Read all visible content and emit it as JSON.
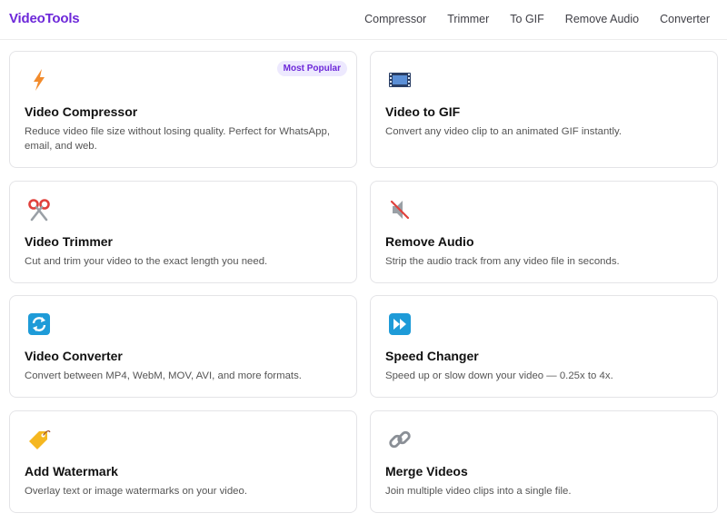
{
  "brand": "VideoTools",
  "nav": [
    "Compressor",
    "Trimmer",
    "To GIF",
    "Remove Audio",
    "Converter"
  ],
  "badge": "Most Popular",
  "cards": [
    {
      "title": "Video Compressor",
      "desc": "Reduce video file size without losing quality. Perfect for WhatsApp, email, and web.",
      "icon": "lightning-icon"
    },
    {
      "title": "Video to GIF",
      "desc": "Convert any video clip to an animated GIF instantly.",
      "icon": "film-icon"
    },
    {
      "title": "Video Trimmer",
      "desc": "Cut and trim your video to the exact length you need.",
      "icon": "scissors-icon"
    },
    {
      "title": "Remove Audio",
      "desc": "Strip the audio track from any video file in seconds.",
      "icon": "muted-speaker-icon"
    },
    {
      "title": "Video Converter",
      "desc": "Convert between MP4, WebM, MOV, AVI, and more formats.",
      "icon": "convert-arrows-icon"
    },
    {
      "title": "Speed Changer",
      "desc": "Speed up or slow down your video — 0.25x to 4x.",
      "icon": "fast-forward-icon"
    },
    {
      "title": "Add Watermark",
      "desc": "Overlay text or image watermarks on your video.",
      "icon": "tag-icon"
    },
    {
      "title": "Merge Videos",
      "desc": "Join multiple video clips into a single file.",
      "icon": "link-icon"
    }
  ],
  "colors": {
    "brand": "#6d28d9",
    "badge_bg": "#ede9fe",
    "border": "#e4e4e7"
  }
}
